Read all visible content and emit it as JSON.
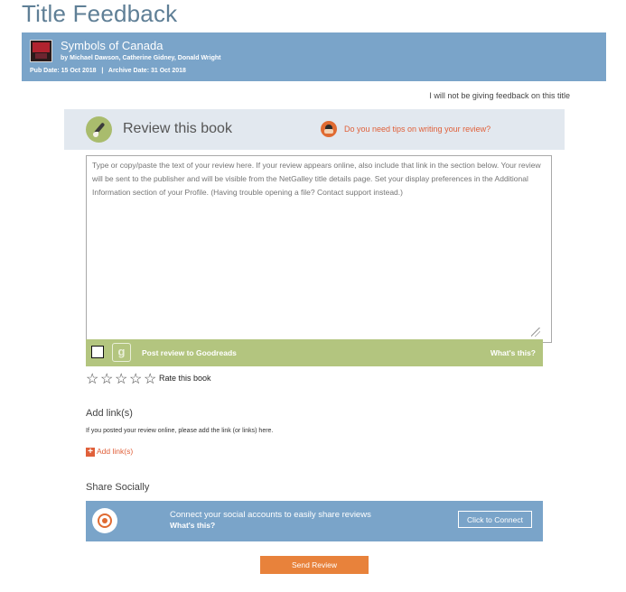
{
  "page": {
    "title": "Title Feedback"
  },
  "book": {
    "title": "Symbols of Canada",
    "authors": "by Michael Dawson, Catherine Gidney, Donald Wright",
    "dates": "Pub Date: 15 Oct 2018   |   Archive Date: 31 Oct 2018"
  },
  "feedback": {
    "no_feedback_link": "I will not be giving feedback on this title"
  },
  "review": {
    "heading": "Review this book",
    "tips_link": "Do you need tips on writing your review?",
    "placeholder": "Type or copy/paste the text of your review here. If your review appears online, also include that link in the section below. Your review will be sent to the publisher and will be visible from the NetGalley title details page. Set your display preferences in the Additional Information section of your Profile. (Having trouble opening a file? Contact support instead.)"
  },
  "goodreads": {
    "icon_letter": "g",
    "label": "Post review to Goodreads",
    "whats_this": "What's this?"
  },
  "rating": {
    "stars": [
      "☆",
      "☆",
      "☆",
      "☆",
      "☆"
    ],
    "label": "Rate this book",
    "value": 0
  },
  "links": {
    "heading": "Add link(s)",
    "description": "If you posted your review online, please add the link (or links) here.",
    "add_label": "Add link(s)",
    "add_icon": "+"
  },
  "share": {
    "heading": "Share Socially",
    "connect_text": "Connect your social accounts to easily share reviews",
    "whats_this": "What's this?",
    "connect_button": "Click to Connect"
  },
  "submit": {
    "label": "Send Review"
  },
  "colors": {
    "title_bar": "#7aa4c9",
    "accent": "#e8823b",
    "goodreads_bar": "#b3c57f"
  }
}
